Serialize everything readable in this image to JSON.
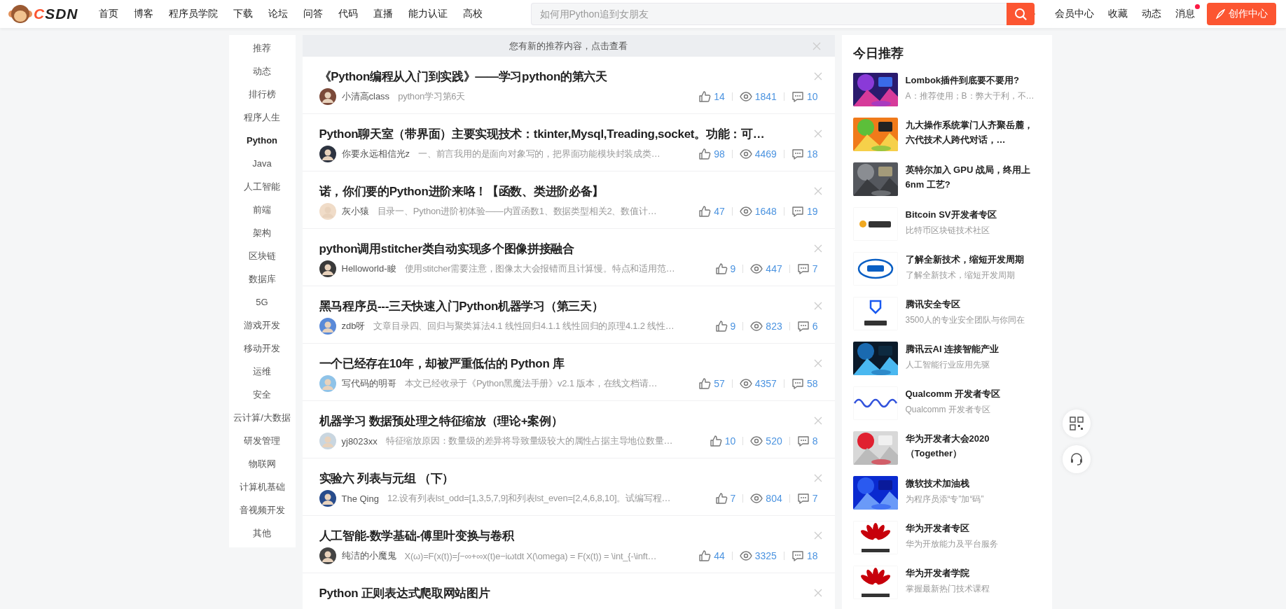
{
  "header": {
    "logo_text": "CSDN",
    "nav": [
      "首页",
      "博客",
      "程序员学院",
      "下载",
      "论坛",
      "问答",
      "代码",
      "直播",
      "能力认证",
      "高校"
    ],
    "search": {
      "placeholder": "如何用Python追到女朋友"
    },
    "user_links": [
      {
        "label": "会员中心",
        "dot": false
      },
      {
        "label": "收藏",
        "dot": false
      },
      {
        "label": "动态",
        "dot": false
      },
      {
        "label": "消息",
        "dot": true
      }
    ],
    "create_button": "创作中心"
  },
  "sidebar": {
    "items": [
      {
        "label": "推荐",
        "selected": false
      },
      {
        "label": "动态",
        "selected": false
      },
      {
        "label": "排行榜",
        "selected": false
      },
      {
        "label": "程序人生",
        "selected": false
      },
      {
        "label": "Python",
        "selected": true
      },
      {
        "label": "Java",
        "selected": false
      },
      {
        "label": "人工智能",
        "selected": false
      },
      {
        "label": "前端",
        "selected": false
      },
      {
        "label": "架构",
        "selected": false
      },
      {
        "label": "区块链",
        "selected": false
      },
      {
        "label": "数据库",
        "selected": false
      },
      {
        "label": "5G",
        "selected": false
      },
      {
        "label": "游戏开发",
        "selected": false
      },
      {
        "label": "移动开发",
        "selected": false
      },
      {
        "label": "运维",
        "selected": false
      },
      {
        "label": "安全",
        "selected": false
      },
      {
        "label": "云计算/大数据",
        "selected": false
      },
      {
        "label": "研发管理",
        "selected": false
      },
      {
        "label": "物联网",
        "selected": false
      },
      {
        "label": "计算机基础",
        "selected": false
      },
      {
        "label": "音视频开发",
        "selected": false
      },
      {
        "label": "其他",
        "selected": false
      }
    ]
  },
  "feed": {
    "notice": "您有新的推荐内容，点击查看",
    "articles": [
      {
        "title": "《Python编程从入门到实践》——学习python的第六天",
        "author": "小清高class",
        "summary": "python学习第6天",
        "likes": "14",
        "views": "1841",
        "comments": "10"
      },
      {
        "title": "Python聊天室（带界面）主要实现技术：tkinter,Mysql,Treading,socket。功能：可…",
        "author": "你要永远相信光z",
        "summary": "一、前言我用的是面向对象写的，把界面功能模块封装成类…",
        "likes": "98",
        "views": "4469",
        "comments": "18"
      },
      {
        "title": "诺，你们要的Python进阶来咯！【函数、类进阶必备】",
        "author": "灰小猿",
        "summary": "目录一、Python进阶初体验——内置函数1、数据类型相关2、数值计…",
        "likes": "47",
        "views": "1648",
        "comments": "19"
      },
      {
        "title": "python调用stitcher类自动实现多个图像拼接融合",
        "author": "Helloworld-睃",
        "summary": "使用stitcher需要注意，图像太大会报错而且计算慢。特点和适用范…",
        "likes": "9",
        "views": "447",
        "comments": "7"
      },
      {
        "title": "黑马程序员---三天快速入门Python机器学习（第三天）",
        "author": "zdb呀",
        "summary": "文章目录四、回归与聚类算法4.1 线性回归4.1.1 线性回归的原理4.1.2 线性…",
        "likes": "9",
        "views": "823",
        "comments": "6"
      },
      {
        "title": "一个已经存在10年，却被严重低估的 Python 库",
        "author": "写代码的明哥",
        "summary": "本文已经收录于《Python黑魔法手册》v2.1 版本，在线文档请…",
        "likes": "57",
        "views": "4357",
        "comments": "58"
      },
      {
        "title": "机器学习 数据预处理之特征缩放（理论+案例）",
        "author": "yj8023xx",
        "summary": "特征缩放原因：数量级的差异将导致量级较大的属性占据主导地位数量…",
        "likes": "10",
        "views": "520",
        "comments": "8"
      },
      {
        "title": "实验六 列表与元组 （下）",
        "author": "The Qing",
        "summary": "12.设有列表lst_odd=[1,3,5,7,9]和列表lst_even=[2,4,6,8,10]。试编写程…",
        "likes": "7",
        "views": "804",
        "comments": "7"
      },
      {
        "title": "人工智能-数学基础-傅里叶变换与卷积",
        "author": "纯洁的小魔鬼",
        "summary": "X(ω)=F(x(t))=∫−∞+∞x(t)e−iωtdt X(\\omega) = F(x(t)) = \\int_{-\\inft…",
        "likes": "44",
        "views": "3325",
        "comments": "18"
      },
      {
        "title": "Python 正则表达式爬取网站图片"
      }
    ]
  },
  "recommend": {
    "title": "今日推荐",
    "items": [
      {
        "kind": "picture",
        "title": "Lombok插件到底要不要用?",
        "desc": "A：推荐使用；B：弊大于利，不…"
      },
      {
        "kind": "picture",
        "title": "九大操作系统掌门人齐聚岳麓，六代技术人跨代对话，…"
      },
      {
        "kind": "picture",
        "title": "英特尔加入 GPU 战局，终用上6nm 工艺?"
      },
      {
        "kind": "coin",
        "title": "Bitcoin SV开发者专区",
        "desc": "比特币区块链技术社区"
      },
      {
        "kind": "ring",
        "title": "了解全新技术，缩短开发周期",
        "desc": "了解全新技术，缩短开发周期"
      },
      {
        "kind": "shield",
        "title": "腾讯安全专区",
        "desc": "3500人的专业安全团队与你同在"
      },
      {
        "kind": "picture",
        "title": "腾讯云AI 连接智能产业",
        "desc": "人工智能行业应用先驱"
      },
      {
        "kind": "wave",
        "title": "Qualcomm 开发者专区",
        "desc": "Qualcomm 开发者专区"
      },
      {
        "kind": "picture",
        "title": "华为开发者大会2020（Together）"
      },
      {
        "kind": "picture",
        "title": "微软技术加油栈",
        "desc": "为程序员添“专”加“码”"
      },
      {
        "kind": "petals",
        "title": "华为开发者专区",
        "desc": "华为开放能力及平台服务"
      },
      {
        "kind": "petals",
        "title": "华为开发者学院",
        "desc": "掌握最新热门技术课程"
      }
    ]
  }
}
